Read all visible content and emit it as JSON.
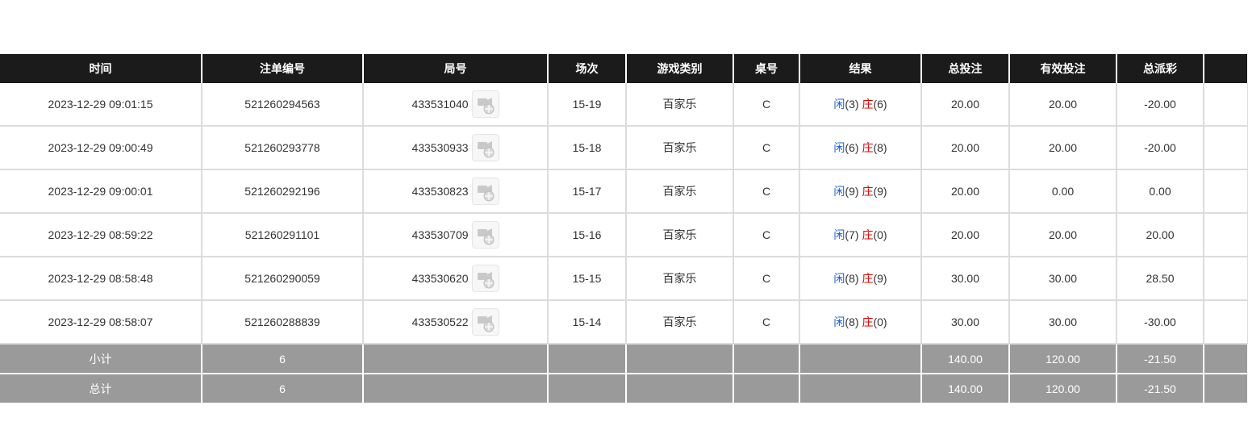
{
  "headers": [
    "时间",
    "注单编号",
    "局号",
    "场次",
    "游戏类别",
    "桌号",
    "结果",
    "总投注",
    "有效投注",
    "总派彩",
    ""
  ],
  "rows": [
    {
      "time": "2023-12-29 09:01:15",
      "bet_id": "521260294563",
      "round": "433531040",
      "session": "15-19",
      "game": "百家乐",
      "table": "C",
      "player_label": "闲",
      "player_score": "(3)",
      "banker_label": "庄",
      "banker_score": "(6)",
      "total_bet": "20.00",
      "valid_bet": "20.00",
      "payout": "-20.00",
      "payout_color": "red"
    },
    {
      "time": "2023-12-29 09:00:49",
      "bet_id": "521260293778",
      "round": "433530933",
      "session": "15-18",
      "game": "百家乐",
      "table": "C",
      "player_label": "闲",
      "player_score": "(6)",
      "banker_label": "庄",
      "banker_score": "(8)",
      "total_bet": "20.00",
      "valid_bet": "20.00",
      "payout": "-20.00",
      "payout_color": "red"
    },
    {
      "time": "2023-12-29 09:00:01",
      "bet_id": "521260292196",
      "round": "433530823",
      "session": "15-17",
      "game": "百家乐",
      "table": "C",
      "player_label": "闲",
      "player_score": "(9)",
      "banker_label": "庄",
      "banker_score": "(9)",
      "total_bet": "20.00",
      "valid_bet": "0.00",
      "payout": "0.00",
      "payout_color": "normal"
    },
    {
      "time": "2023-12-29 08:59:22",
      "bet_id": "521260291101",
      "round": "433530709",
      "session": "15-16",
      "game": "百家乐",
      "table": "C",
      "player_label": "闲",
      "player_score": "(7)",
      "banker_label": "庄",
      "banker_score": "(0)",
      "total_bet": "20.00",
      "valid_bet": "20.00",
      "payout": "20.00",
      "payout_color": "normal"
    },
    {
      "time": "2023-12-29 08:58:48",
      "bet_id": "521260290059",
      "round": "433530620",
      "session": "15-15",
      "game": "百家乐",
      "table": "C",
      "player_label": "闲",
      "player_score": "(8)",
      "banker_label": "庄",
      "banker_score": "(9)",
      "total_bet": "30.00",
      "valid_bet": "30.00",
      "payout": "28.50",
      "payout_color": "normal"
    },
    {
      "time": "2023-12-29 08:58:07",
      "bet_id": "521260288839",
      "round": "433530522",
      "session": "15-14",
      "game": "百家乐",
      "table": "C",
      "player_label": "闲",
      "player_score": "(8)",
      "banker_label": "庄",
      "banker_score": "(0)",
      "total_bet": "30.00",
      "valid_bet": "30.00",
      "payout": "-30.00",
      "payout_color": "red"
    }
  ],
  "summary": [
    {
      "label": "小计",
      "count": "6",
      "total_bet": "140.00",
      "valid_bet": "120.00",
      "payout": "-21.50"
    },
    {
      "label": "总计",
      "count": "6",
      "total_bet": "140.00",
      "valid_bet": "120.00",
      "payout": "-21.50"
    }
  ],
  "colors": {
    "header_bg": "#1b1b1b",
    "summary_bg": "#9a9a9a",
    "blue": "#1a5fd6",
    "red": "#e00000"
  },
  "icons": {
    "round_video": "video-replay-icon"
  }
}
